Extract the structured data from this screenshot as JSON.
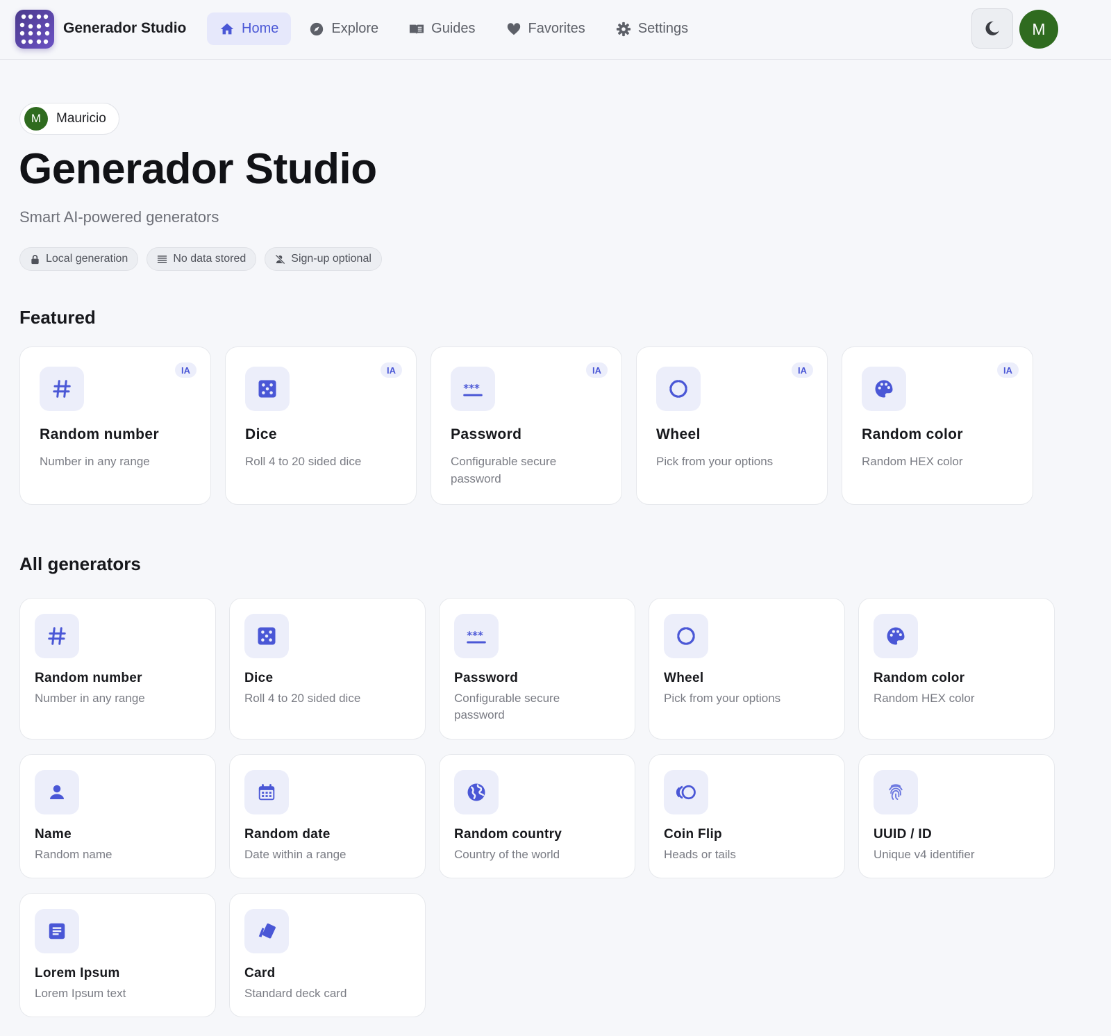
{
  "app": {
    "brand": "Generador Studio",
    "accent": "#4a57d6",
    "avatar_initial": "M"
  },
  "nav": [
    {
      "label": "Home",
      "icon": "home-icon",
      "active": true
    },
    {
      "label": "Explore",
      "icon": "compass-icon",
      "active": false
    },
    {
      "label": "Guides",
      "icon": "book-icon",
      "active": false
    },
    {
      "label": "Favorites",
      "icon": "heart-icon",
      "active": false
    },
    {
      "label": "Settings",
      "icon": "gear-icon",
      "active": false
    }
  ],
  "hero": {
    "user_initial": "M",
    "user_name": "Mauricio",
    "title": "Generador Studio",
    "subtitle": "Smart AI-powered generators",
    "badges": [
      {
        "label": "Local generation",
        "icon": "lock-icon"
      },
      {
        "label": "No data stored",
        "icon": "list-icon"
      },
      {
        "label": "Sign-up optional",
        "icon": "no-user-icon"
      }
    ]
  },
  "featured": {
    "title": "Featured",
    "tag": "IA",
    "cards": [
      {
        "title": "Random number",
        "desc": "Number in any range",
        "icon": "hash-icon"
      },
      {
        "title": "Dice",
        "desc": "Roll 4 to 20 sided dice",
        "icon": "dice-icon"
      },
      {
        "title": "Password",
        "desc": "Configurable secure password",
        "icon": "password-icon"
      },
      {
        "title": "Wheel",
        "desc": "Pick from your options",
        "icon": "wheel-icon"
      },
      {
        "title": "Random color",
        "desc": "Random HEX color",
        "icon": "palette-icon"
      }
    ]
  },
  "all": {
    "title": "All generators",
    "cards": [
      {
        "title": "Random number",
        "desc": "Number in any range",
        "icon": "hash-icon"
      },
      {
        "title": "Dice",
        "desc": "Roll 4 to 20 sided dice",
        "icon": "dice-icon"
      },
      {
        "title": "Password",
        "desc": "Configurable secure password",
        "icon": "password-icon"
      },
      {
        "title": "Wheel",
        "desc": "Pick from your options",
        "icon": "wheel-icon"
      },
      {
        "title": "Random color",
        "desc": "Random HEX color",
        "icon": "palette-icon"
      },
      {
        "title": "Name",
        "desc": "Random name",
        "icon": "person-icon"
      },
      {
        "title": "Random date",
        "desc": "Date within a range",
        "icon": "calendar-icon"
      },
      {
        "title": "Random country",
        "desc": "Country of the world",
        "icon": "globe-icon"
      },
      {
        "title": "Coin Flip",
        "desc": "Heads or tails",
        "icon": "coin-icon"
      },
      {
        "title": "UUID / ID",
        "desc": "Unique v4 identifier",
        "icon": "fingerprint-icon"
      },
      {
        "title": "Lorem Ipsum",
        "desc": "Lorem Ipsum text",
        "icon": "document-icon"
      },
      {
        "title": "Card",
        "desc": "Standard deck card",
        "icon": "cards-icon"
      }
    ]
  }
}
